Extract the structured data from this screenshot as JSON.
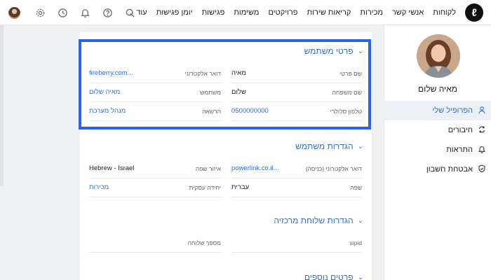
{
  "brand": {
    "logo_glyph": "ℓ",
    "accent": "#2f6fd1",
    "highlight": "#2a63e6"
  },
  "topbar": {
    "nav": [
      "לקוחות",
      "אנשי קשר",
      "מכירות",
      "קריאות שירות",
      "פרויקטים",
      "משימות",
      "פגישות",
      "יומן פגישות"
    ],
    "more_label": "עוד",
    "icons": [
      "search-icon",
      "help-icon",
      "bell-icon",
      "clock-icon",
      "gear-icon"
    ]
  },
  "sidebar": {
    "name": "מאיה שלום",
    "items": [
      {
        "label": "הפרופיל שלי",
        "icon": "user-icon",
        "active": true
      },
      {
        "label": "חיבורים",
        "icon": "sync-icon",
        "active": false
      },
      {
        "label": "התראות",
        "icon": "bell-icon",
        "active": false
      },
      {
        "label": "אבטחת חשבון",
        "icon": "shield-icon",
        "active": false
      }
    ]
  },
  "sections": {
    "user_details": {
      "title": "פרטי משתמש",
      "fields": {
        "first_name": {
          "label": "שם פרטי",
          "value": "מאיה"
        },
        "last_name": {
          "label": "שם משפחה",
          "value": "שלום"
        },
        "mobile": {
          "label": "טלפון סלולרי",
          "value": "0500000000"
        },
        "email": {
          "label": "דואר אלקטרוני",
          "value": "fireberry.com..."
        },
        "user": {
          "label": "משתמש",
          "value": "מאיה שלום"
        },
        "permission": {
          "label": "הרשאה",
          "value": "מנהל מערכת"
        }
      }
    },
    "user_settings": {
      "title": "הגדרות משתמש",
      "fields": {
        "login_email": {
          "label": "דואר אלקטרוני (כניסה)",
          "value": "powerlink.co.il..."
        },
        "language": {
          "label": "שפה",
          "value": "עברית"
        },
        "locale": {
          "label": "איזור שפה",
          "value": "Hebrew - Israel"
        },
        "business_unit": {
          "label": "יחידה עסקית",
          "value": "מכירות"
        }
      }
    },
    "central_settings": {
      "title": "הגדרות שלוחת מרכזיה",
      "fields": {
        "sipid": {
          "label": "sipid",
          "value": ""
        },
        "extension": {
          "label": "מספר שלוחה",
          "value": ""
        }
      }
    },
    "more_details": {
      "title": "פרטים נוספים"
    }
  }
}
